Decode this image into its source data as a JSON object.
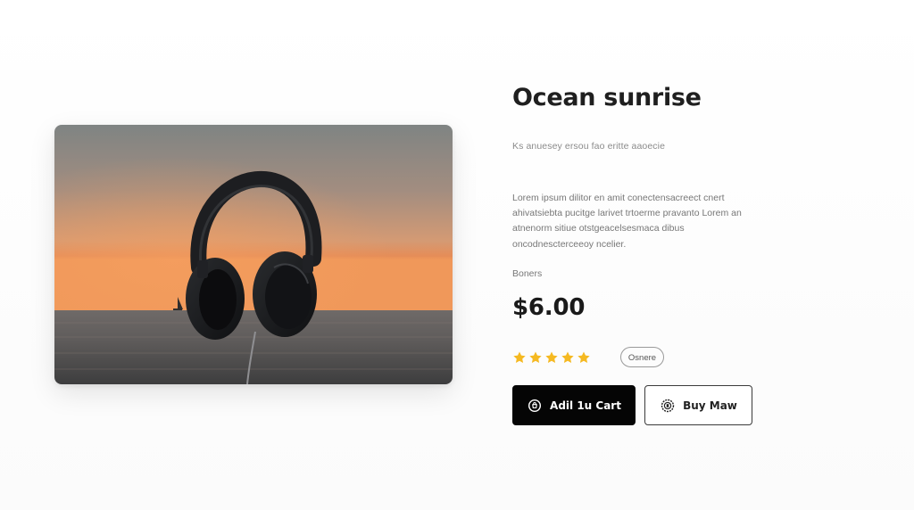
{
  "product": {
    "image_alt": "Headphones against ocean sunrise",
    "title": "Ocean sunrise",
    "subtitle": "Ks anuesey ersou fao eritte aaoecie",
    "description": "Lorem ipsum dilitor en amit conectensacreect cnert ahivatsiebta pucitge larivet trtoerme pravanto Lorem an atnenorm sitiue otstgeacelsesmaca dibus oncodnescterceeoy ncelier.",
    "label": "Boners",
    "price": "$6.00",
    "rating": {
      "value": 5,
      "max": 5,
      "star_color": "#F5B921",
      "reviews_label": "Osnere"
    }
  },
  "actions": {
    "add_to_cart_label": "Adil 1u Cart",
    "buy_now_label": "Buy Maw"
  },
  "colors": {
    "primary_button": "#050505",
    "title_text": "#1F1F1F",
    "muted_text": "#777777"
  },
  "icons": {
    "add_to_cart": "bag-icon",
    "buy_now": "badge-icon",
    "rating": "star-icon"
  }
}
